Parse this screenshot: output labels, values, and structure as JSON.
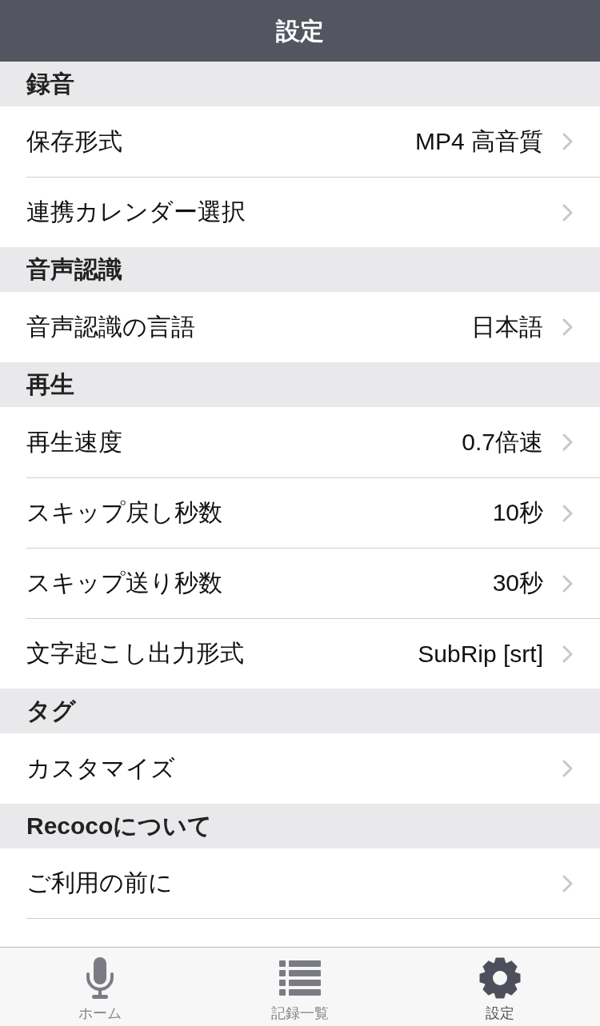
{
  "nav_bar": {
    "title": "設定"
  },
  "sections": [
    {
      "title": "録音",
      "items": [
        {
          "label": "保存形式",
          "value": "MP4 高音質"
        },
        {
          "label": "連携カレンダー選択"
        }
      ]
    },
    {
      "title": "音声認識",
      "items": [
        {
          "label": "音声認識の言語",
          "value": "日本語"
        }
      ]
    },
    {
      "title": "再生",
      "items": [
        {
          "label": "再生速度",
          "value": "0.7倍速"
        },
        {
          "label": "スキップ戻し秒数",
          "value": "10秒"
        },
        {
          "label": "スキップ送り秒数",
          "value": "30秒"
        },
        {
          "label": "文字起こし出力形式",
          "value": "SubRip [srt]"
        }
      ]
    },
    {
      "title": "タグ",
      "items": [
        {
          "label": "カスタマイズ"
        }
      ]
    },
    {
      "title": "Recocoについて",
      "items": [
        {
          "label": "ご利用の前に"
        }
      ]
    }
  ],
  "tab_bar": {
    "tabs": [
      {
        "label": "ホーム",
        "kind": "mic",
        "selected": false
      },
      {
        "label": "記録一覧",
        "kind": "list",
        "selected": false
      },
      {
        "label": "設定",
        "kind": "gear",
        "selected": true
      }
    ]
  }
}
